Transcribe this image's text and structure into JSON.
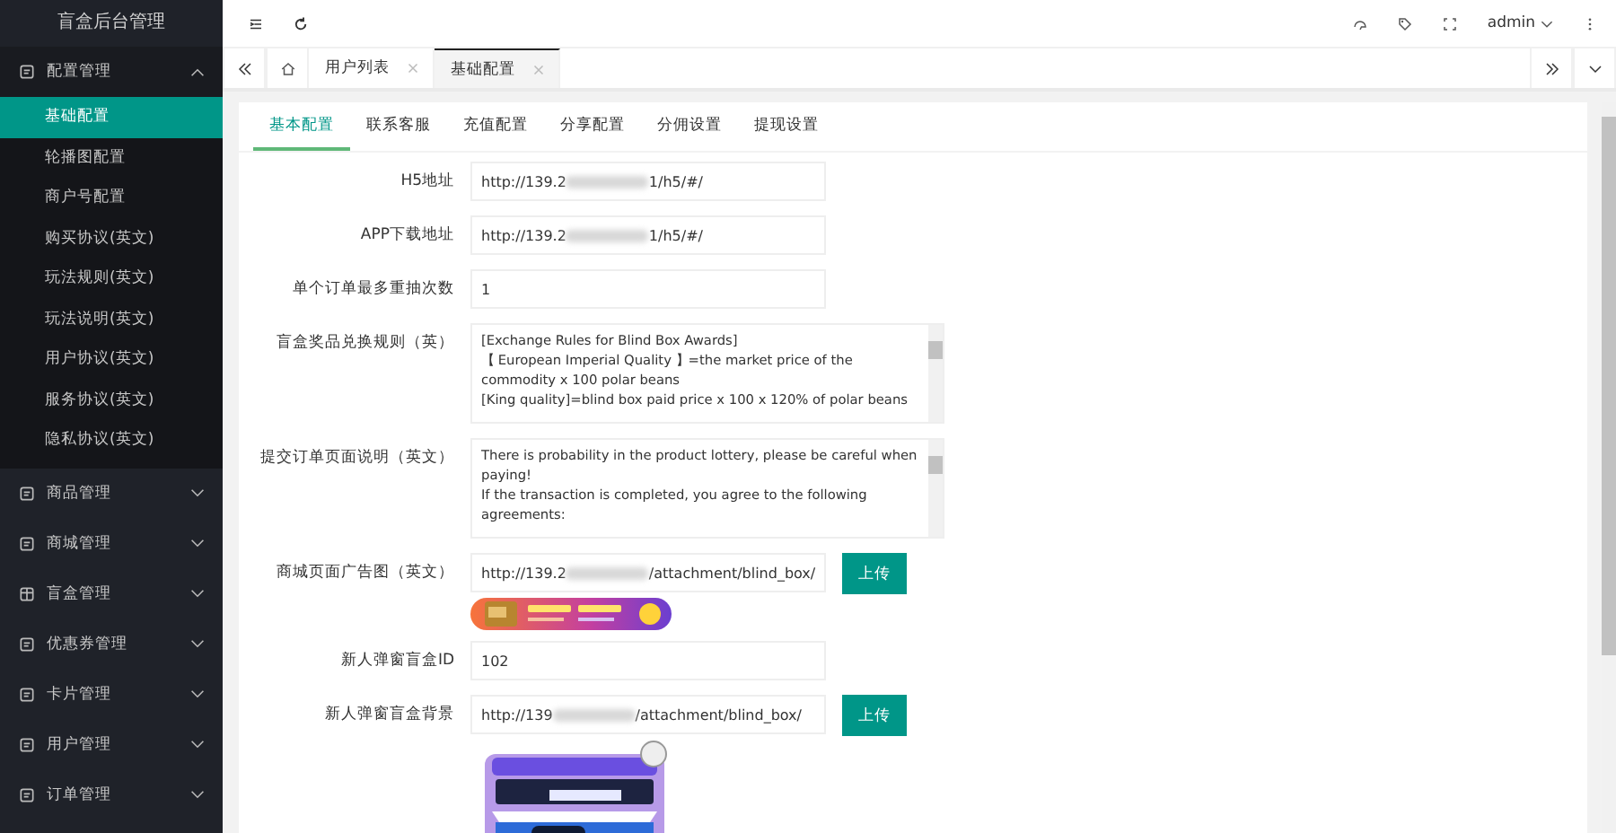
{
  "sidebar": {
    "title": "盲盒后台管理",
    "menus": [
      {
        "label": "配置管理",
        "expanded": true,
        "children": [
          {
            "label": "基础配置",
            "selected": true
          },
          {
            "label": "轮播图配置",
            "selected": false
          },
          {
            "label": "商户号配置",
            "selected": false
          },
          {
            "label": "购买协议(英文)",
            "selected": false
          },
          {
            "label": "玩法规则(英文)",
            "selected": false
          },
          {
            "label": "玩法说明(英文)",
            "selected": false
          },
          {
            "label": "用户协议(英文)",
            "selected": false
          },
          {
            "label": "服务协议(英文)",
            "selected": false
          },
          {
            "label": "隐私协议(英文)",
            "selected": false
          }
        ]
      },
      {
        "label": "商品管理",
        "expanded": false
      },
      {
        "label": "商城管理",
        "expanded": false
      },
      {
        "label": "盲盒管理",
        "expanded": false
      },
      {
        "label": "优惠券管理",
        "expanded": false
      },
      {
        "label": "卡片管理",
        "expanded": false
      },
      {
        "label": "用户管理",
        "expanded": false
      },
      {
        "label": "订单管理",
        "expanded": false
      }
    ]
  },
  "header": {
    "user": "admin"
  },
  "page_tabs": [
    {
      "label": "用户列表",
      "selected": false
    },
    {
      "label": "基础配置",
      "selected": true
    }
  ],
  "config_tabs": [
    {
      "label": "基本配置",
      "selected": true
    },
    {
      "label": "联系客服",
      "selected": false
    },
    {
      "label": "充值配置",
      "selected": false
    },
    {
      "label": "分享配置",
      "selected": false
    },
    {
      "label": "分佣设置",
      "selected": false
    },
    {
      "label": "提现设置",
      "selected": false
    }
  ],
  "form": [
    {
      "kind": "input",
      "label": "H5地址",
      "value_start": "http://139.2",
      "value_end": "1/h5/#/"
    },
    {
      "kind": "input",
      "label": "APP下载地址",
      "value_start": "http://139.2",
      "value_end": "1/h5/#/"
    },
    {
      "kind": "input",
      "label": "单个订单最多重抽次数",
      "value_start": "1"
    },
    {
      "kind": "textarea",
      "label": "盲盒奖品兑换规则（英）",
      "lines": [
        "[Exchange Rules for Blind Box Awards]",
        "【 European Imperial Quality 】=the market price of the commodity x 100 polar beans",
        "[King quality]=blind box paid price x 100 x 120% of polar beans"
      ]
    },
    {
      "kind": "textarea",
      "label": "提交订单页面说明（英文）",
      "lines": [
        "There is probability in the product lottery, please be careful when paying!",
        "If the transaction is completed, you agree to the following agreements:"
      ]
    },
    {
      "kind": "upload",
      "label": "商城页面广告图（英文）",
      "value_start": "http://139.2",
      "value_end": "/attachment/blind_box/",
      "button": "上传",
      "preview": true
    },
    {
      "kind": "input",
      "label": "新人弹窗盲盒ID",
      "value_start": "102"
    },
    {
      "kind": "upload",
      "label": "新人弹窗盲盒背景",
      "value_start": "http://139",
      "value_end": "/attachment/blind_box/",
      "button": "上传",
      "preview": true
    }
  ]
}
